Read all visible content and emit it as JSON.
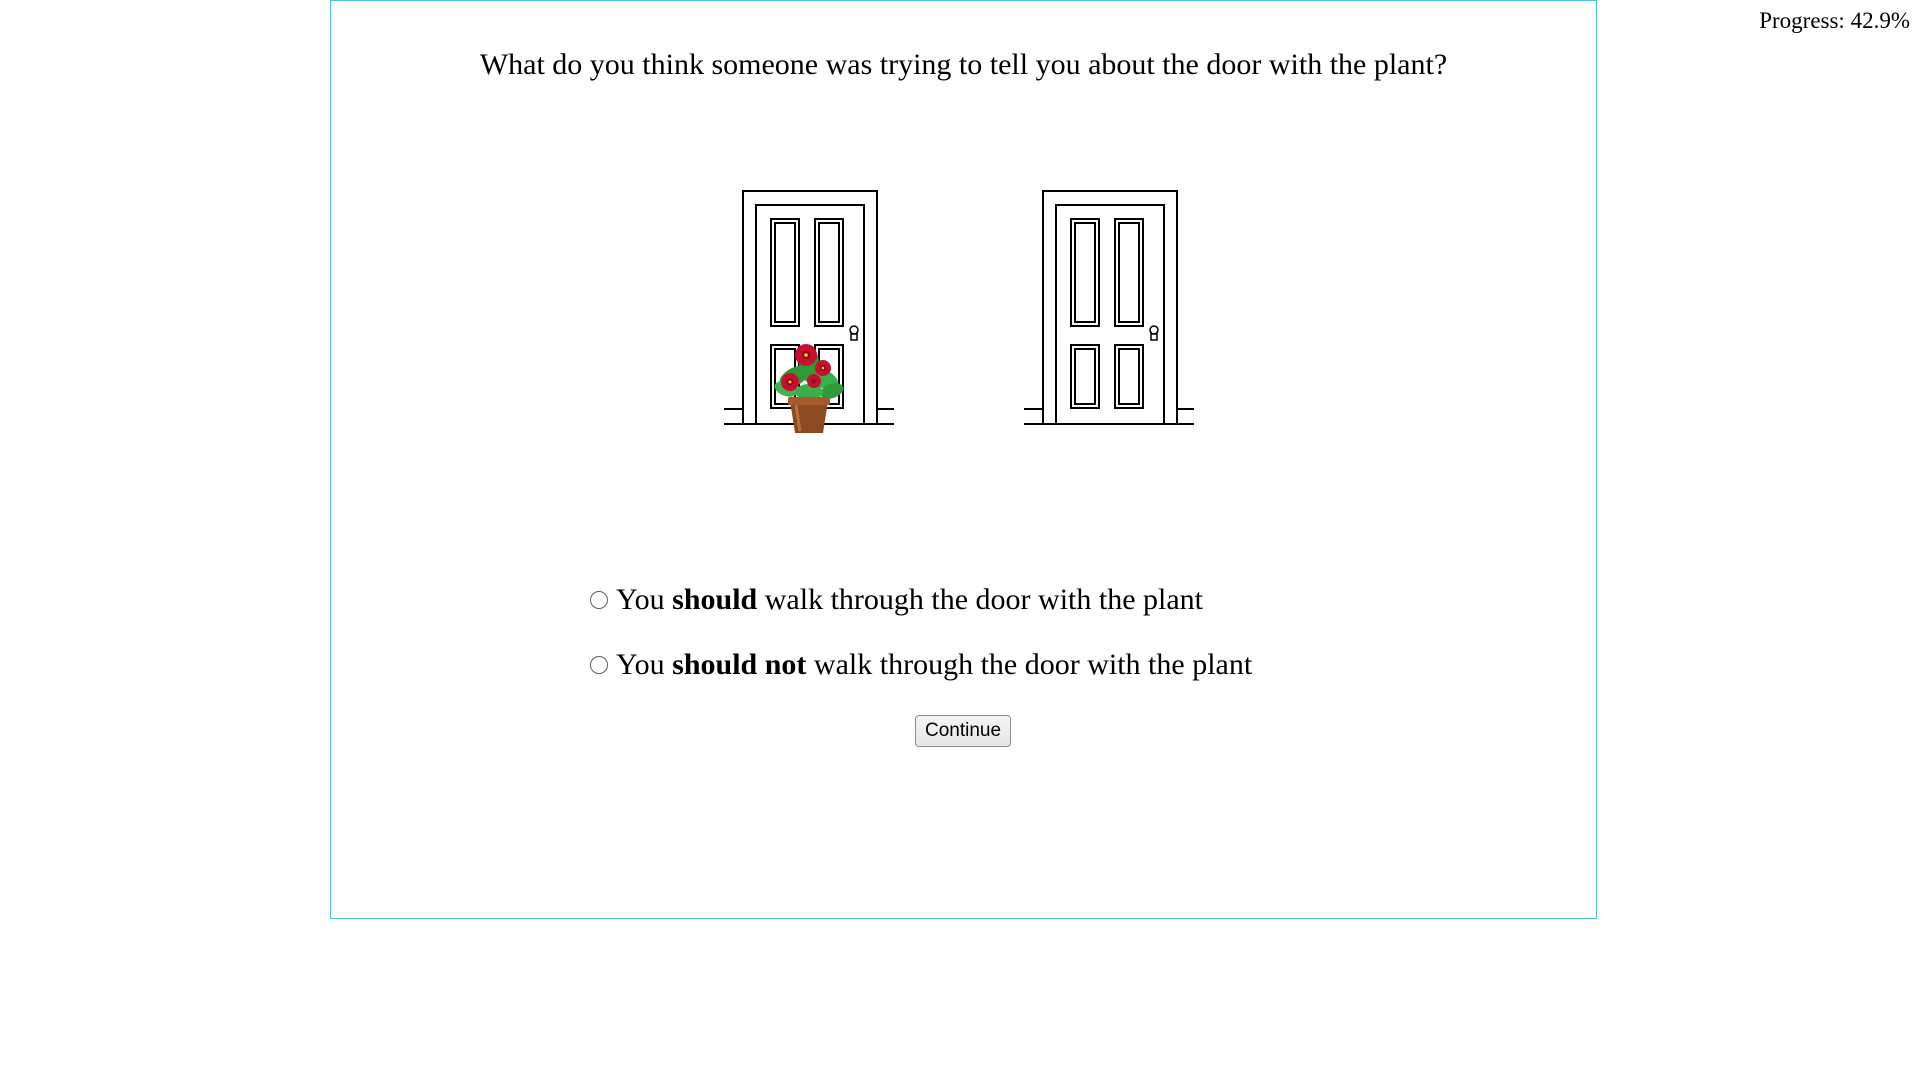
{
  "progress": {
    "label": "Progress:",
    "value": "42.9%"
  },
  "question": "What do you think someone was trying to tell you about the door with the plant?",
  "images": {
    "left_door": "door-with-plant",
    "right_door": "plain-door"
  },
  "options": [
    {
      "pre": "You ",
      "bold": "should",
      "post": " walk through the door with the plant",
      "selected": false
    },
    {
      "pre": "You ",
      "bold": "should not",
      "post": " walk through the door with the plant",
      "selected": false
    }
  ],
  "continue_label": "Continue",
  "colors": {
    "frame_border": "#4fc3d7",
    "flower_red": "#c8102e",
    "leaf_green": "#2e9a3a",
    "pot_brown": "#8b4a22"
  }
}
